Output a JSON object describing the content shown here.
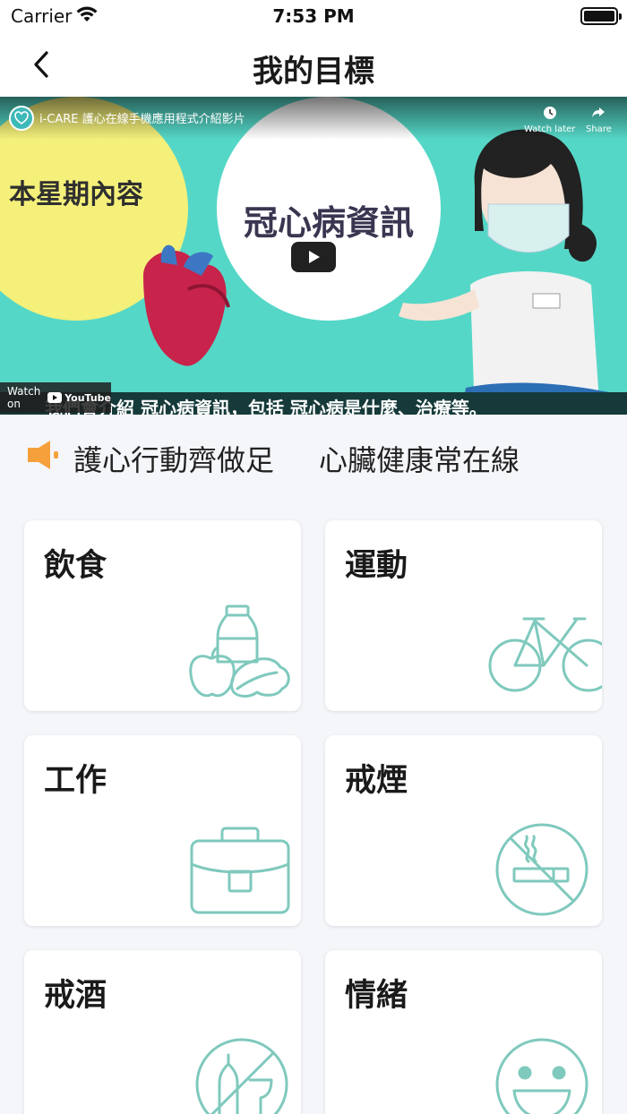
{
  "status_bar": {
    "carrier": "Carrier",
    "time": "7:53 PM"
  },
  "nav": {
    "title": "我的目標"
  },
  "video": {
    "title": "i-CARE 護心在線手機應用程式介紹影片",
    "watch_later": "Watch later",
    "share": "Share",
    "thumbnail_left_text": "本星期內容",
    "thumbnail_center_text": "冠心病資訊",
    "subtitle": "我們會介紹 冠心病資訊，包括 冠心病是什麼、治療等。",
    "watch_on": "Watch on",
    "youtube": "YouTube"
  },
  "slogan": {
    "part1": "護心行動齊做足",
    "part2": "心臟健康常在線"
  },
  "cards": [
    {
      "label": "飲食",
      "icon": "food-icon"
    },
    {
      "label": "運動",
      "icon": "bicycle-icon"
    },
    {
      "label": "工作",
      "icon": "briefcase-icon"
    },
    {
      "label": "戒煙",
      "icon": "no-smoking-icon"
    },
    {
      "label": "戒酒",
      "icon": "no-alcohol-icon"
    },
    {
      "label": "情緒",
      "icon": "smiley-icon"
    }
  ],
  "colors": {
    "accent": "#7fc9bd",
    "speaker": "#f5a03a",
    "background": "#f5f6fa"
  }
}
